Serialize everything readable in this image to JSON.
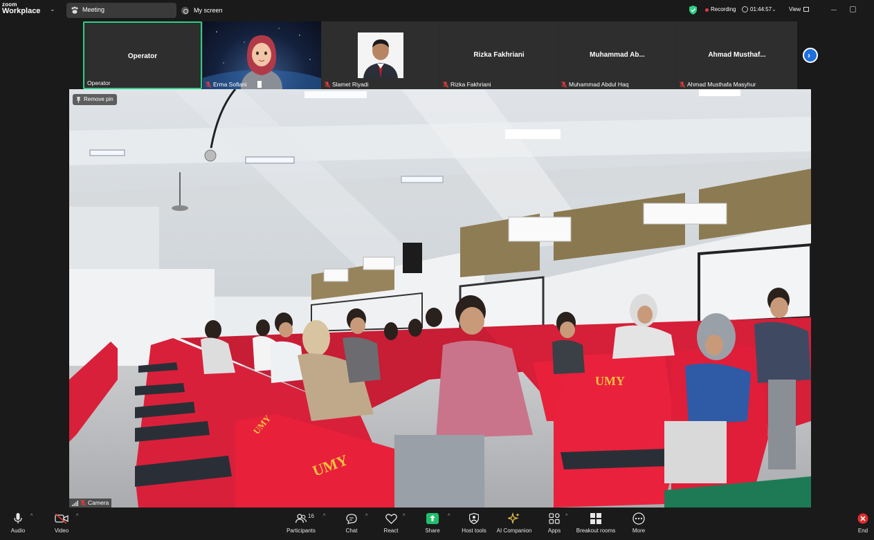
{
  "app": {
    "logo_line1": "zoom",
    "logo_line2": "Workplace"
  },
  "tabs": {
    "meeting": "Meeting",
    "my_screen": "My screen"
  },
  "status": {
    "recording": "Recording",
    "elapsed": "01:44:57",
    "view": "View"
  },
  "thumbnails": [
    {
      "center_name": "Operator",
      "label": "Operator",
      "muted": false,
      "active_speaker": true
    },
    {
      "center_name": "",
      "label": "Erma Sofiani",
      "muted": true,
      "has_video": true
    },
    {
      "center_name": "",
      "label": "Slamet Riyadi",
      "muted": true,
      "has_photo": true
    },
    {
      "center_name": "Rizka Fakhriani",
      "label": "Rizka Fakhriani",
      "muted": true
    },
    {
      "center_name": "Muhammad  Ab...",
      "label": "Muhammad Abdul Haq",
      "muted": true
    },
    {
      "center_name": "Ahmad  Musthaf...",
      "label": "Ahmad Musthafa Masyhur",
      "muted": true
    }
  ],
  "main_video": {
    "remove_pin": "Remove pin",
    "camera_label": "Camera",
    "seat_brand": "UMY"
  },
  "toolbar": {
    "audio": "Audio",
    "video": "Video",
    "participants": "Participants",
    "participant_count": "16",
    "chat": "Chat",
    "react": "React",
    "share": "Share",
    "host_tools": "Host tools",
    "ai_companion": "AI Companion",
    "apps": "Apps",
    "breakout_rooms": "Breakout rooms",
    "more": "More",
    "end": "End"
  },
  "colors": {
    "accent_green": "#2ecf87",
    "recording_red": "#e83b3b",
    "share_green": "#1fbf6a",
    "next_blue": "#1e6fe0",
    "seat_red": "#e8203a"
  }
}
